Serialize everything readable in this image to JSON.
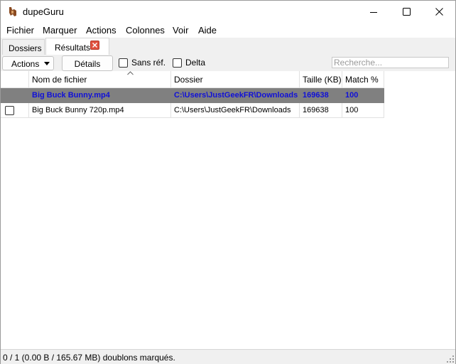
{
  "window": {
    "title": "dupeGuru"
  },
  "menu": [
    "Fichier",
    "Marquer",
    "Actions",
    "Colonnes",
    "Voir",
    "Aide"
  ],
  "tabs": [
    {
      "label": "Dossiers",
      "active": false
    },
    {
      "label": "Résultats",
      "active": true
    }
  ],
  "toolbar": {
    "actions_label": "Actions",
    "details_label": "Détails",
    "sans_ref_label": "Sans réf.",
    "sans_ref_checked": false,
    "delta_label": "Delta",
    "delta_checked": false,
    "search_placeholder": "Recherche...",
    "search_value": ""
  },
  "table": {
    "columns": [
      "",
      "Nom de fichier",
      "Dossier",
      "Taille (KB)",
      "Match %"
    ],
    "sorted_column": "Nom de fichier",
    "rows": [
      {
        "is_reference": true,
        "checked": false,
        "name": "Big Buck Bunny.mp4",
        "folder": "C:\\Users\\JustGeekFR\\Downloads",
        "size": "169638",
        "match": "100"
      },
      {
        "is_reference": false,
        "checked": false,
        "name": "Big Buck Bunny 720p.mp4",
        "folder": "C:\\Users\\JustGeekFR\\Downloads",
        "size": "169638",
        "match": "100"
      }
    ]
  },
  "status": {
    "text": "0 / 1 (0.00 B / 165.67 MB) doublons marqués."
  },
  "colors": {
    "reference_row_bg": "#808080",
    "reference_row_text": "#1010d8",
    "tab_close": "#e0513e"
  }
}
